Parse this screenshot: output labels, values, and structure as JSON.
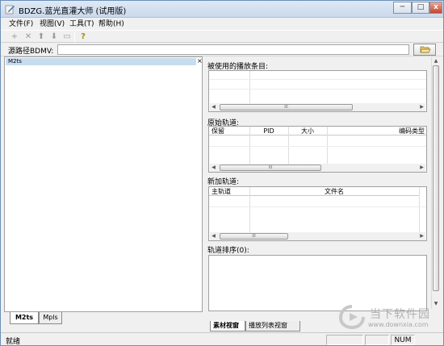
{
  "window": {
    "title": "BDZG.蓝光直灌大师 (试用版)",
    "controls": {
      "minimize": "─",
      "maximize": "□",
      "close": "x"
    }
  },
  "menu": [
    "文件(F)",
    "视图(V)",
    "工具(T)",
    "帮助(H)"
  ],
  "toolbar": {
    "buttons": [
      {
        "name": "add-icon",
        "glyph": "+"
      },
      {
        "name": "remove-icon",
        "glyph": "✕"
      },
      {
        "name": "move-up-icon",
        "glyph": "⬆"
      },
      {
        "name": "move-down-icon",
        "glyph": "⬇"
      },
      {
        "name": "film-icon",
        "glyph": "▭"
      },
      {
        "name": "help-icon",
        "glyph": "?"
      }
    ]
  },
  "source_path": {
    "label": "源路径BDMV:",
    "value": "",
    "browse_icon": "folder-open-icon"
  },
  "left_panel": {
    "header": "M2ts",
    "close": "×",
    "tabs": [
      "M2ts",
      "Mpls"
    ]
  },
  "playlist_section": {
    "label": "被使用的播放条目:"
  },
  "original_tracks": {
    "label": "原始轨道:",
    "columns": [
      "保留",
      "PID",
      "大小",
      "编码类型"
    ]
  },
  "new_tracks": {
    "label": "新加轨道:",
    "columns": [
      "主轨道",
      "文件名"
    ]
  },
  "track_order": {
    "label": "轨道排序(0):"
  },
  "bottom_tabs": [
    "素材视窗",
    "播放列表视窗"
  ],
  "scroll": {
    "thumb_grip": "III"
  },
  "status": {
    "text": "就绪",
    "num": "NUM"
  },
  "watermark": {
    "text": "当下软件园",
    "url": "www.downxia.com"
  }
}
